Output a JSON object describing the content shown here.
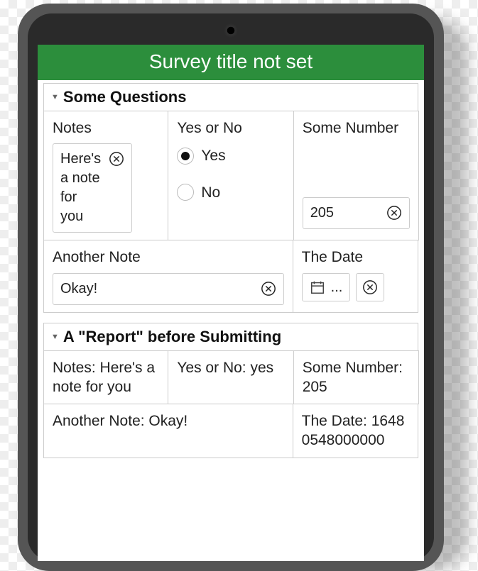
{
  "survey_title": "Survey title not set",
  "sections": {
    "questions": {
      "header": "Some Questions",
      "notes": {
        "label": "Notes",
        "value": "Here's a note for you"
      },
      "yes_no": {
        "label": "Yes or No",
        "options": {
          "yes": "Yes",
          "no": "No"
        },
        "selected": "yes"
      },
      "number": {
        "label": "Some Number",
        "value": "205"
      },
      "another_note": {
        "label": "Another Note",
        "value": "Okay!"
      },
      "date": {
        "label": "The Date",
        "display": "..."
      }
    },
    "report": {
      "header": "A \"Report\" before Submitting",
      "notes_line": "Notes: Here's a note for you",
      "yes_no_line": "Yes or No: yes",
      "number_line": "Some Number: 205",
      "another_note_line": "Another Note: Okay!",
      "date_line": "The Date: 16480548000000"
    }
  }
}
